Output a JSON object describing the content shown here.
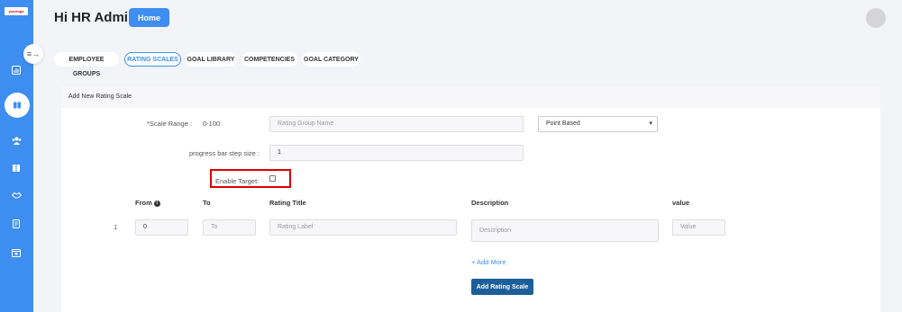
{
  "sidebar": {
    "logo_text": "yourlogo",
    "icons": [
      "dashboard-icon",
      "book-icon",
      "users-icon",
      "library-icon",
      "handshake-icon",
      "report-icon",
      "calendar-icon"
    ],
    "toggle_icon": "collapse-icon"
  },
  "header": {
    "greeting": "Hi HR Admin",
    "home_label": "Home"
  },
  "tabs": [
    {
      "label": "EMPLOYEE GROUPS",
      "active": false
    },
    {
      "label": "RATING SCALES",
      "active": true
    },
    {
      "label": "GOAL LIBRARY",
      "active": false
    },
    {
      "label": "COMPETENCIES",
      "active": false
    },
    {
      "label": "GOAL CATEGORY",
      "active": false
    }
  ],
  "form": {
    "section_title": "Add New Rating Scale",
    "scale_range_label": "*Scale Range :",
    "scale_range_value": "0-100",
    "rating_group_placeholder": "Rating Group Name",
    "scale_type_selected": "Point Based",
    "step_size_label": "progress bar step size :",
    "step_size_value": "1",
    "enable_target_label": "Enable Target:",
    "columns": {
      "from": "From",
      "to": "To",
      "rating_title": "Rating Title",
      "description": "Description",
      "value": "value"
    },
    "rows": [
      {
        "index": "1",
        "from_value": "0",
        "to_placeholder": "To",
        "title_placeholder": "Rating Label",
        "description_placeholder": "Description",
        "value_placeholder": "Value"
      }
    ],
    "add_more_label": "+ Add More",
    "submit_label": "Add Rating Scale"
  }
}
